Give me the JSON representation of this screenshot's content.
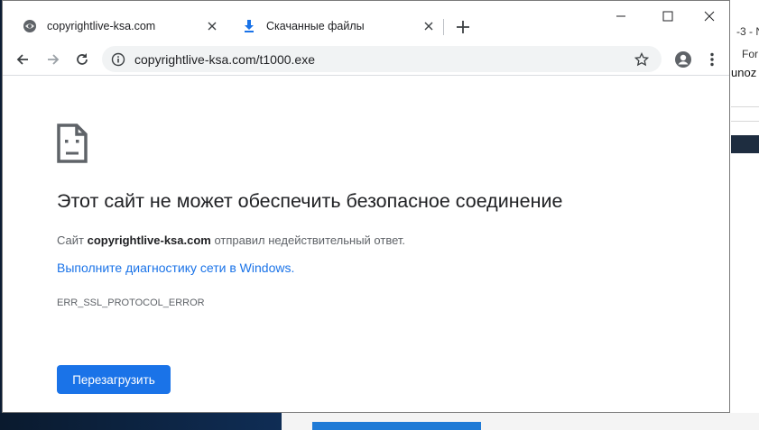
{
  "background": {
    "right_texts": [
      "-3 - N",
      "For",
      "unoz"
    ]
  },
  "tabs": [
    {
      "title": "copyrightlive-ksa.com",
      "icon": "globe-icon",
      "active": true
    },
    {
      "title": "Скачанные файлы",
      "icon": "download-icon",
      "active": false
    }
  ],
  "omnibox": {
    "url": "copyrightlive-ksa.com/t1000.exe"
  },
  "error_page": {
    "icon": "sad-document-icon",
    "title": "Этот сайт не может обеспечить безопасное соединение",
    "desc_prefix": "Сайт ",
    "desc_site": "copyrightlive-ksa.com",
    "desc_suffix": " отправил недействительный ответ.",
    "link": "Выполните диагностику сети в Windows.",
    "code": "ERR_SSL_PROTOCOL_ERROR",
    "reload_label": "Перезагрузить"
  },
  "colors": {
    "accent": "#1a73e8",
    "text": "#202124",
    "secondary_text": "#5f6368"
  }
}
